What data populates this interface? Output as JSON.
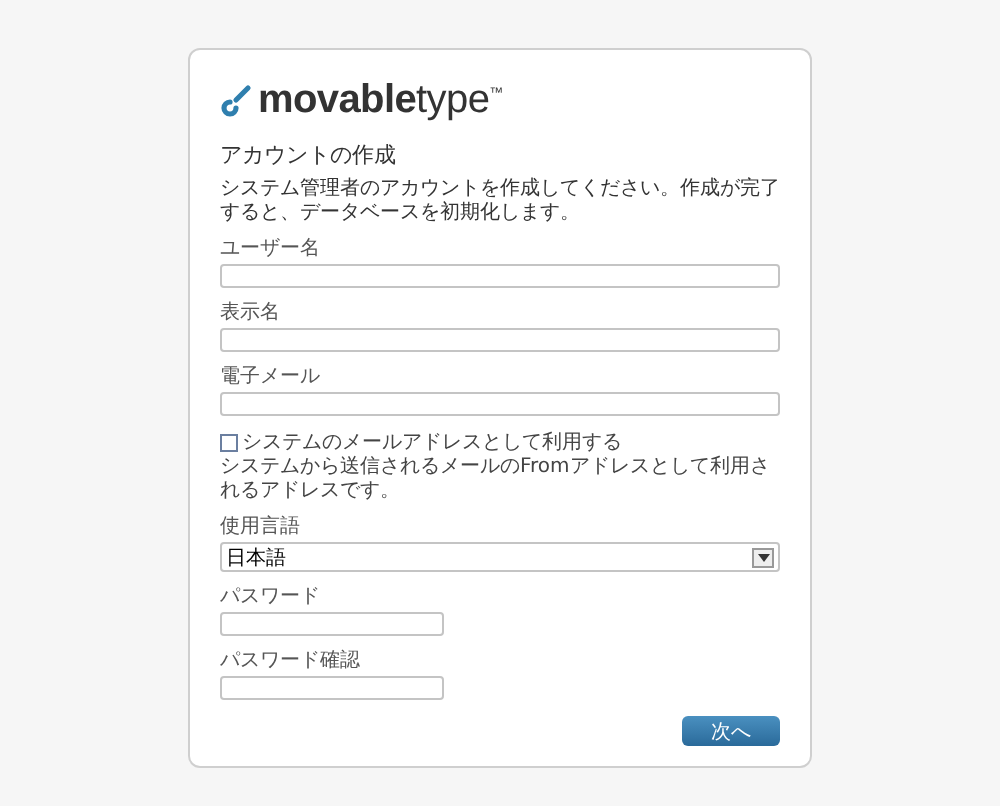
{
  "logo": {
    "strong": "movable",
    "light": "type",
    "mark": "™"
  },
  "title": "アカウントの作成",
  "description": "システム管理者のアカウントを作成してください。作成が完了すると、データベースを初期化します。",
  "fields": [
    {
      "kind": "text",
      "label": "ユーザー名"
    },
    {
      "kind": "text",
      "label": "表示名"
    },
    {
      "kind": "text",
      "label": "電子メール"
    },
    {
      "kind": "checkbox",
      "label": "システムのメールアドレスとして利用する",
      "checked": false,
      "hint": "システムから送信されるメールのFromアドレスとして利用されるアドレスです。"
    },
    {
      "kind": "select",
      "label": "使用言語",
      "value": "日本語"
    },
    {
      "kind": "short",
      "label": "パスワード"
    },
    {
      "kind": "short",
      "label": "パスワード確認"
    }
  ],
  "button": "次へ"
}
